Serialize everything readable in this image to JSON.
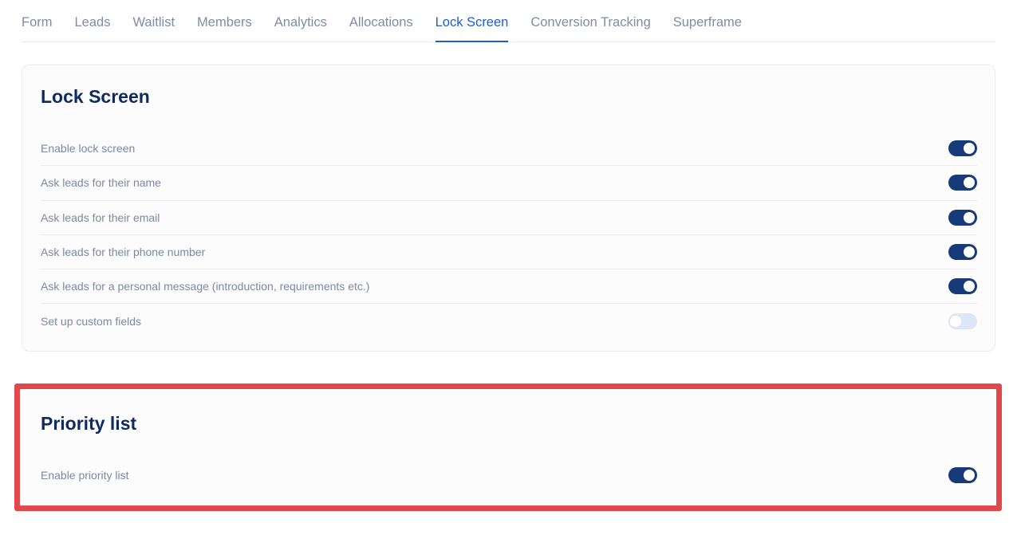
{
  "tabs": [
    {
      "label": "Form",
      "active": false
    },
    {
      "label": "Leads",
      "active": false
    },
    {
      "label": "Waitlist",
      "active": false
    },
    {
      "label": "Members",
      "active": false
    },
    {
      "label": "Analytics",
      "active": false
    },
    {
      "label": "Allocations",
      "active": false
    },
    {
      "label": "Lock Screen",
      "active": true
    },
    {
      "label": "Conversion Tracking",
      "active": false
    },
    {
      "label": "Superframe",
      "active": false
    }
  ],
  "lock_screen": {
    "title": "Lock Screen",
    "settings": [
      {
        "label": "Enable lock screen",
        "enabled": true
      },
      {
        "label": "Ask leads for their name",
        "enabled": true
      },
      {
        "label": "Ask leads for their email",
        "enabled": true
      },
      {
        "label": "Ask leads for their phone number",
        "enabled": true
      },
      {
        "label": "Ask leads for a personal message (introduction, requirements etc.)",
        "enabled": true
      },
      {
        "label": "Set up custom fields",
        "enabled": false
      }
    ]
  },
  "priority_list": {
    "title": "Priority list",
    "settings": [
      {
        "label": "Enable priority list",
        "enabled": true
      }
    ]
  },
  "colors": {
    "accent": "#1f5bd0",
    "toggle_on": "#163a7a",
    "toggle_off": "#dce6f7",
    "highlight": "#e2474b",
    "title": "#0f2a5e",
    "muted_text": "#7a89a6"
  }
}
